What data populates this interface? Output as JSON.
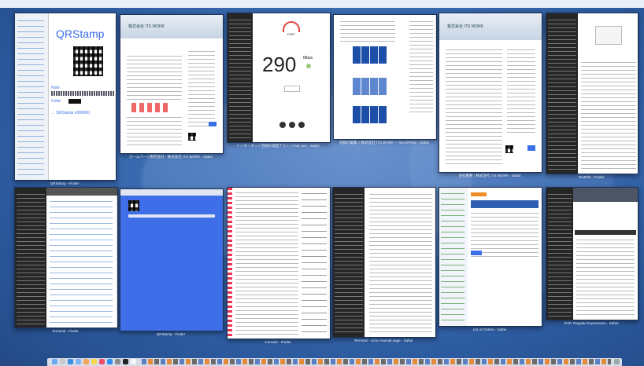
{
  "qrstamp": {
    "title": "QRStamp",
    "note_label": "Note:",
    "color_label": "Color:",
    "link_text": "← QRStamp v000000"
  },
  "speedtest": {
    "logo": "FAST",
    "value": "290",
    "unit": "Mbps"
  },
  "site_title": "株式会社 ITS WORK",
  "windows": [
    {
      "id": "w1",
      "caption": "QRStamp - Finder"
    },
    {
      "id": "w2",
      "caption": "ホームページ制作会社 - 株式会社 ITS WORK - Safari"
    },
    {
      "id": "w3",
      "caption": "インターネット回線の速度テスト | Fast.com - Safari"
    },
    {
      "id": "w4",
      "caption": "投稿の編集 < 株式会社 ITS WORK — WordPress - Safari"
    },
    {
      "id": "w5",
      "caption": "会社概要 | 株式会社 ITS WORK - Safari"
    },
    {
      "id": "w6",
      "caption": "TextEdit - Finder"
    },
    {
      "id": "w7",
      "caption": "Terminal - Finder"
    },
    {
      "id": "w8",
      "caption": "QRStamp - Finder"
    },
    {
      "id": "w9",
      "caption": "Console - Finder"
    },
    {
      "id": "w10",
      "caption": "Terminal - Linux manual page - Safari"
    },
    {
      "id": "w11",
      "caption": "List of Orders - Safari"
    },
    {
      "id": "w12",
      "caption": "PHP: Regular Expressions - Safari"
    }
  ],
  "colors": {
    "desktop": "#3e6fb5",
    "accent_blue": "#3b6fe8",
    "speed_red": "#e0463a",
    "terminal": "#262626"
  },
  "dock_icons": [
    "finder-icon",
    "launchpad-icon",
    "safari-icon",
    "mail-icon",
    "photos-icon",
    "notes-icon",
    "music-icon",
    "appstore-icon",
    "settings-icon",
    "terminal-icon",
    "textedit-icon",
    "trash-icon"
  ]
}
